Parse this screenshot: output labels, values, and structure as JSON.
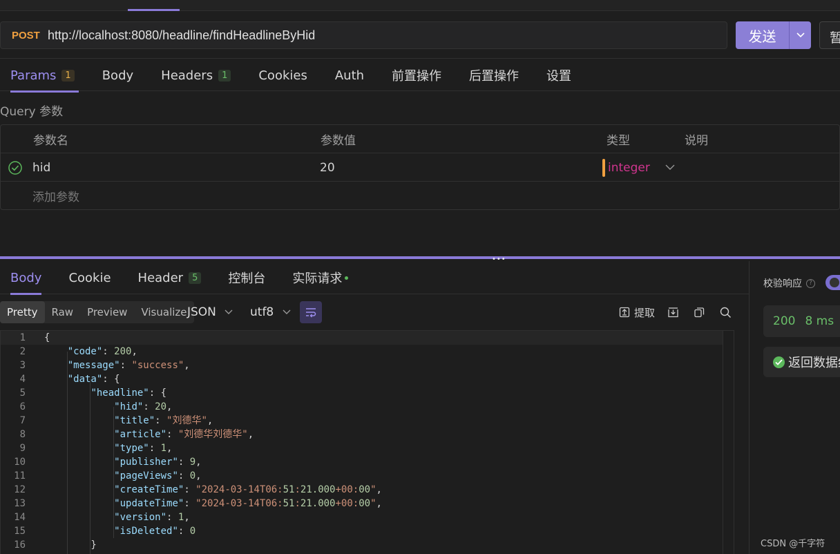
{
  "request": {
    "method": "POST",
    "url": "http://localhost:8080/headline/findHeadlineByHid",
    "send_label": "发送",
    "save_label": "暂"
  },
  "request_tabs": [
    {
      "label": "Params",
      "badge": "1",
      "active": true
    },
    {
      "label": "Body",
      "badge": "",
      "active": false
    },
    {
      "label": "Headers",
      "badge": "1",
      "active": false
    },
    {
      "label": "Cookies",
      "badge": "",
      "active": false
    },
    {
      "label": "Auth",
      "badge": "",
      "active": false
    },
    {
      "label": "前置操作",
      "badge": "",
      "active": false
    },
    {
      "label": "后置操作",
      "badge": "",
      "active": false
    },
    {
      "label": "设置",
      "badge": "",
      "active": false
    }
  ],
  "params": {
    "section_label": "Query 参数",
    "headers": {
      "name": "参数名",
      "value": "参数值",
      "type": "类型",
      "desc": "说明"
    },
    "rows": [
      {
        "name": "hid",
        "value": "20",
        "type": "integer",
        "desc": ""
      }
    ],
    "add_placeholder": "添加参数"
  },
  "response_tabs": [
    {
      "label": "Body",
      "badge": "",
      "active": true
    },
    {
      "label": "Cookie",
      "badge": "",
      "active": false
    },
    {
      "label": "Header",
      "badge": "5",
      "active": false
    },
    {
      "label": "控制台",
      "badge": "",
      "active": false
    },
    {
      "label": "实际请求",
      "badge": "",
      "active": false,
      "dot": true
    }
  ],
  "view": {
    "modes": [
      "Pretty",
      "Raw",
      "Preview",
      "Visualize"
    ],
    "active_mode": "Pretty",
    "format": "JSON",
    "encoding": "utf8",
    "extract_label": "提取"
  },
  "response_lines": [
    "{",
    "    \"code\": 200,",
    "    \"message\": \"success\",",
    "    \"data\": {",
    "        \"headline\": {",
    "            \"hid\": 20,",
    "            \"title\": \"刘德华\",",
    "            \"article\": \"刘德华刘德华\",",
    "            \"type\": 1,",
    "            \"publisher\": 9,",
    "            \"pageViews\": 0,",
    "            \"createTime\": \"2024-03-14T06:51:21.000+00:00\",",
    "            \"updateTime\": \"2024-03-14T06:51:21.000+00:00\",",
    "            \"version\": 1,",
    "            \"isDeleted\": 0",
    "        }"
  ],
  "right_panel": {
    "verify_label": "校验响应",
    "status_code": "200",
    "elapsed": "8 ms",
    "result_label": "返回数据结"
  },
  "watermark": "CSDN @千字符",
  "colors": {
    "accent": "#8a7ad8",
    "method": "#f0a040",
    "success": "#5cb85c",
    "type": "#d0358e"
  }
}
